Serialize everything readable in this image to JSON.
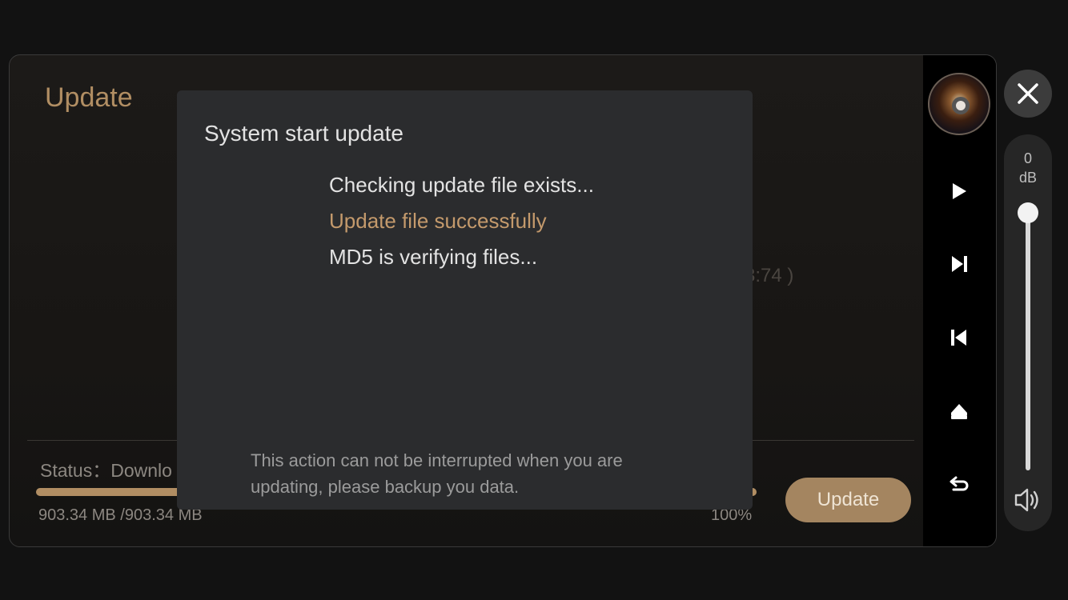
{
  "page": {
    "title": "Update",
    "background_partial_text": "3:74 )",
    "status_text": "Status：Downlo",
    "size_text": "903.34 MB /903.34 MB",
    "percent_text": "100%",
    "progress": 1.0,
    "update_button": "Update"
  },
  "dialog": {
    "title": "System start update",
    "log": [
      "Checking update file exists...",
      "Update file successfully",
      "MD5 is verifying files..."
    ],
    "note": "This action can not be interrupted when you are updating, please backup you data."
  },
  "volume": {
    "value": "0",
    "unit": "dB",
    "level": 1.0
  },
  "icons": {
    "close": "close-icon",
    "play": "play-icon",
    "next": "skip-next-icon",
    "previous": "skip-previous-icon",
    "eject": "eject-icon",
    "back": "back-arrow-icon",
    "speaker": "speaker-icon"
  },
  "colors": {
    "accent": "#b18e63",
    "success_text": "#c49a6c",
    "dialog_bg": "#2b2c2e"
  }
}
